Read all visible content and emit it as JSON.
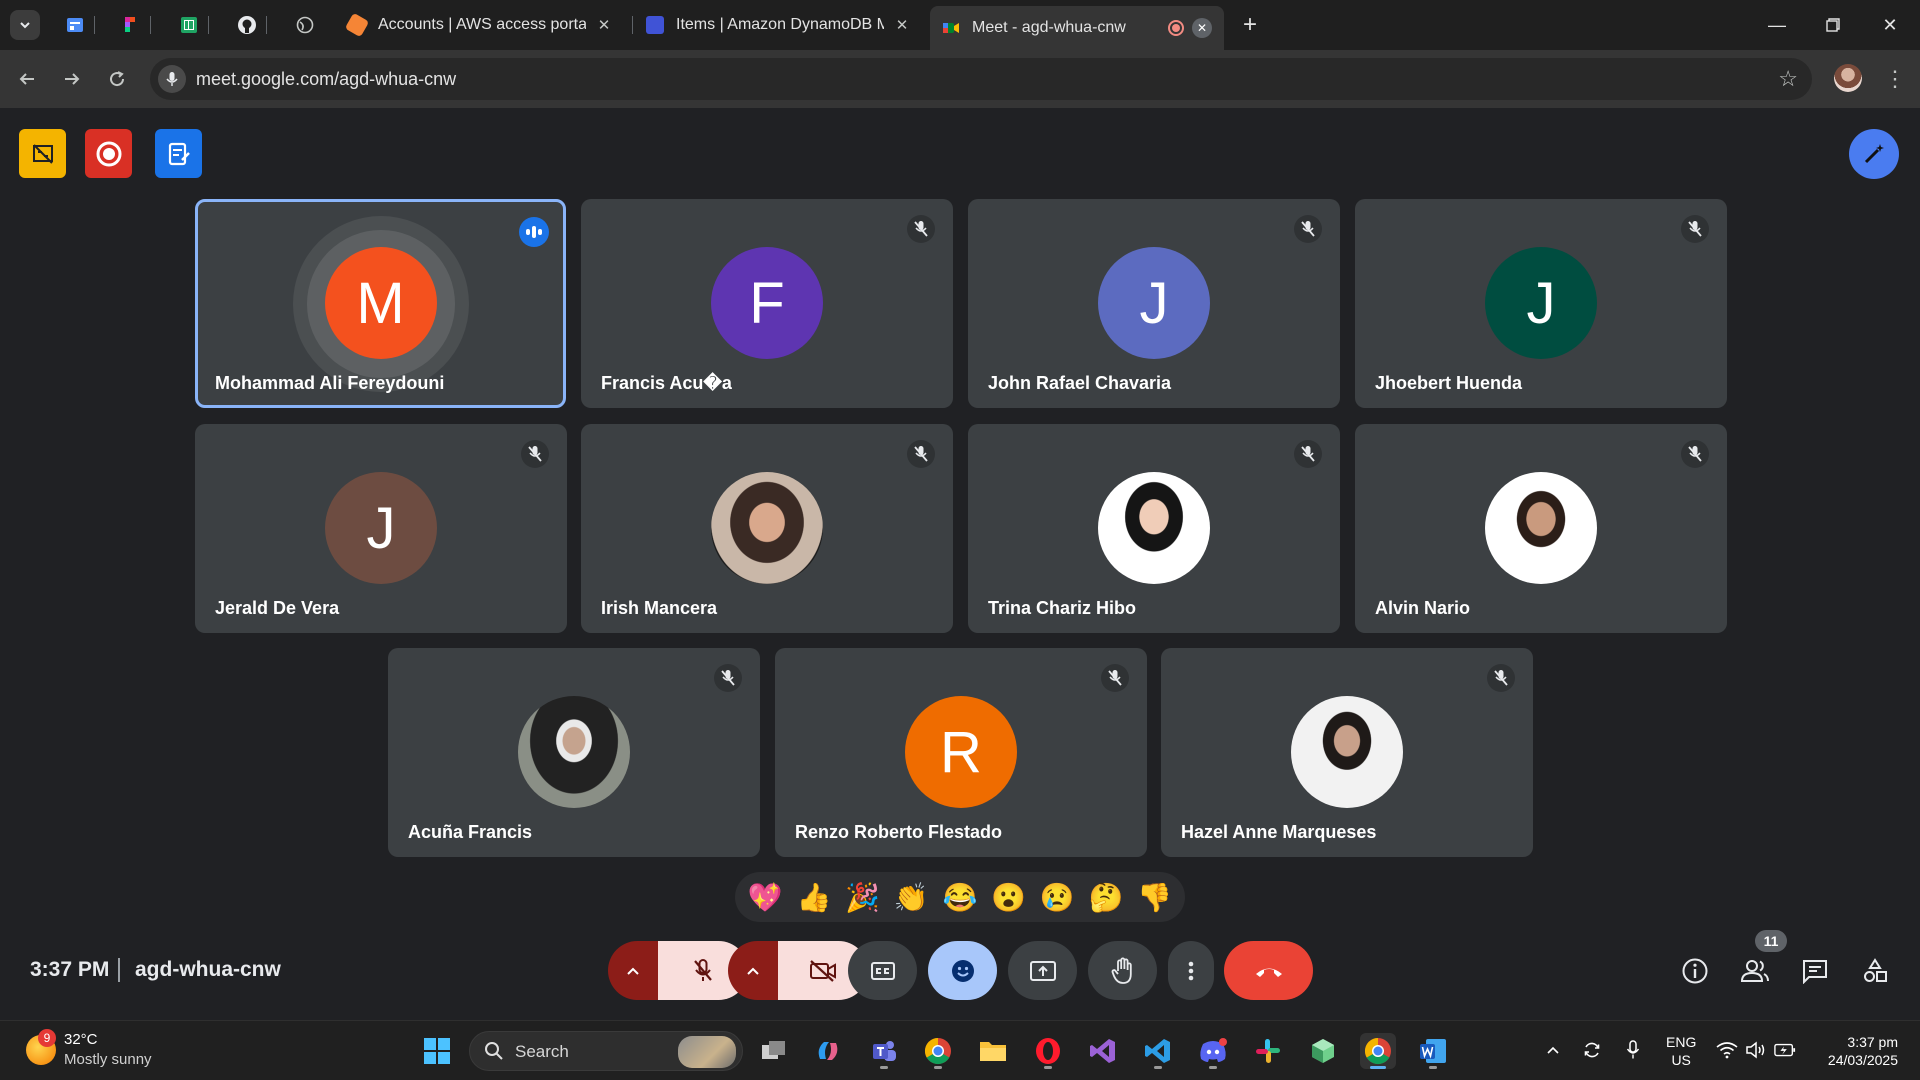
{
  "browser": {
    "tabs": [
      {
        "title": "Accounts | AWS access portal",
        "favicon_color": "#f58536"
      },
      {
        "title": "Items | Amazon DynamoDB Ma",
        "favicon_color": "#4053d6"
      },
      {
        "title": "Meet - agd-whua-cnw",
        "favicon_color": "#00832d"
      }
    ],
    "url": "meet.google.com/agd-whua-cnw"
  },
  "participants": [
    {
      "name": "Mohammad Ali Fereydouni",
      "initial": "M",
      "color": "#f4511e",
      "speaking": true
    },
    {
      "name": "Francis Acu�a",
      "initial": "F",
      "color": "#5e35b1",
      "muted": true
    },
    {
      "name": "John Rafael Chavaria",
      "initial": "J",
      "color": "#5c6bc0",
      "muted": true
    },
    {
      "name": "Jhoebert Huenda",
      "initial": "J",
      "color": "#004d40",
      "muted": true
    },
    {
      "name": "Jerald De Vera",
      "initial": "J",
      "color": "#6d4c41",
      "muted": true
    },
    {
      "name": "Irish Mancera",
      "photo": "photo-1",
      "muted": true
    },
    {
      "name": "Trina Chariz Hibo",
      "photo": "photo-2",
      "muted": true
    },
    {
      "name": "Alvin Nario",
      "photo": "photo-3",
      "muted": true
    },
    {
      "name": "Acuña Francis",
      "photo": "photo-4",
      "muted": true
    },
    {
      "name": "Renzo Roberto Flestado",
      "initial": "R",
      "color": "#ef6c00",
      "muted": true
    },
    {
      "name": "Hazel Anne Marqueses",
      "photo": "photo-5",
      "muted": true
    }
  ],
  "reactions": [
    "💖",
    "👍",
    "🎉",
    "👏",
    "😂",
    "😮",
    "😢",
    "🤔",
    "👎"
  ],
  "meeting": {
    "time": "3:37 PM",
    "code": "agd-whua-cnw",
    "participant_count": "11"
  },
  "taskbar": {
    "weather_badge": "9",
    "temperature": "32°C",
    "condition": "Mostly sunny",
    "search_label": "Search",
    "lang_line1": "ENG",
    "lang_line2": "US",
    "time": "3:37 pm",
    "date": "24/03/2025"
  }
}
